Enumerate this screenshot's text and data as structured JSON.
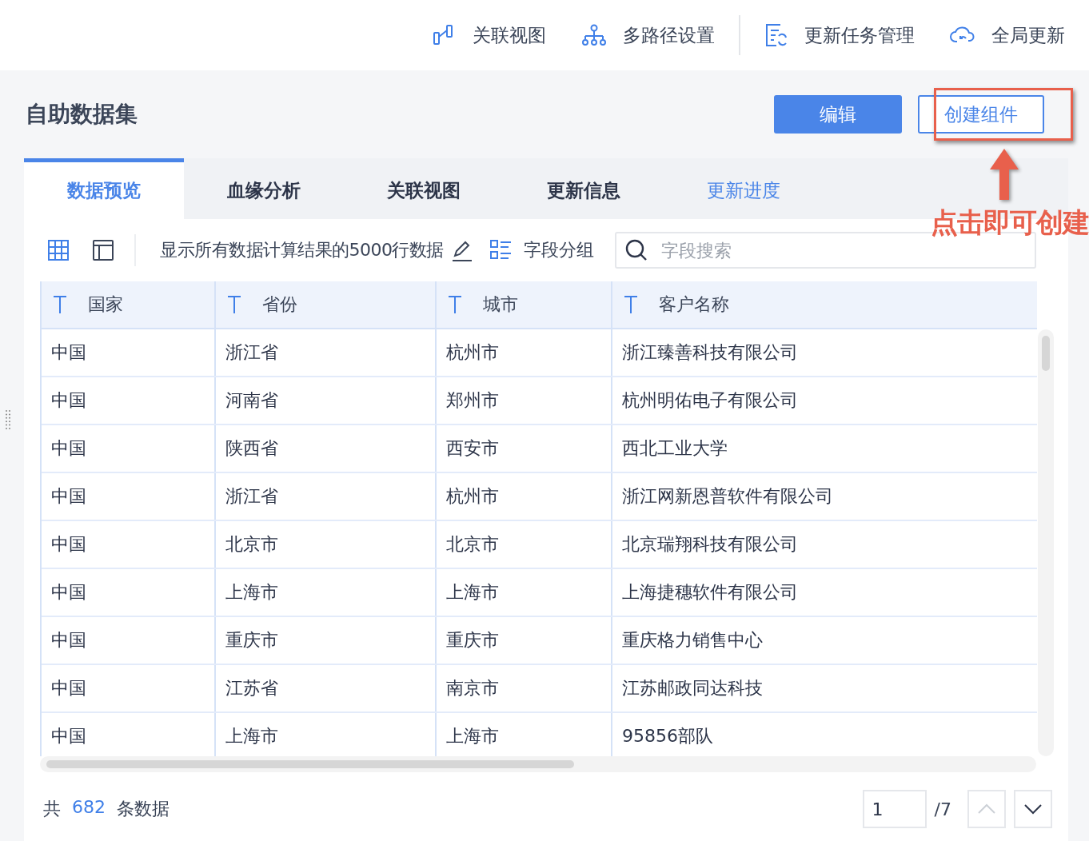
{
  "toolbar": [
    {
      "kind": "view",
      "label": "关联视图"
    },
    {
      "kind": "path",
      "label": "多路径设置"
    },
    {
      "kind": "task",
      "label": "更新任务管理"
    },
    {
      "kind": "cloud",
      "label": "全局更新"
    }
  ],
  "title": "自助数据集",
  "buttons": [
    {
      "kind": "primary",
      "label": "编辑"
    },
    {
      "kind": "outline",
      "label": "创建组件"
    }
  ],
  "annotation": {
    "text": "点击即可创建"
  },
  "tabs": [
    {
      "label": "数据预览",
      "selected": true,
      "kind": "tab"
    },
    {
      "label": "血缘分析",
      "selected": false,
      "kind": "tab"
    },
    {
      "label": "关联视图",
      "selected": false,
      "kind": "tab"
    },
    {
      "label": "更新信息",
      "selected": false,
      "kind": "tab"
    },
    {
      "label": "更新进度",
      "selected": false,
      "kind": "link"
    }
  ],
  "view_modes": [
    {
      "kind": "grid",
      "selected": true
    },
    {
      "kind": "layout",
      "selected": false
    }
  ],
  "info_text": "显示所有数据计算结果的5000行数据",
  "group_button": "字段分组",
  "search": {
    "placeholder": "字段搜索"
  },
  "table": {
    "columns": [
      "国家",
      "省份",
      "城市",
      "客户名称"
    ],
    "rows": [
      [
        "中国",
        "浙江省",
        "杭州市",
        "浙江臻善科技有限公司"
      ],
      [
        "中国",
        "河南省",
        "郑州市",
        "杭州明佑电子有限公司"
      ],
      [
        "中国",
        "陕西省",
        "西安市",
        "西北工业大学"
      ],
      [
        "中国",
        "浙江省",
        "杭州市",
        "浙江网新恩普软件有限公司"
      ],
      [
        "中国",
        "北京市",
        "北京市",
        "北京瑞翔科技有限公司"
      ],
      [
        "中国",
        "上海市",
        "上海市",
        "上海捷穗软件有限公司"
      ],
      [
        "中国",
        "重庆市",
        "重庆市",
        "重庆格力销售中心"
      ],
      [
        "中国",
        "江苏省",
        "南京市",
        "江苏邮政同达科技"
      ],
      [
        "中国",
        "上海市",
        "上海市",
        "95856部队"
      ]
    ]
  },
  "footer": {
    "prefix": "共",
    "count": "682",
    "suffix": "条数据"
  },
  "pager": {
    "value": "1",
    "total": "/7",
    "prev_disabled": true,
    "next_disabled": false
  }
}
